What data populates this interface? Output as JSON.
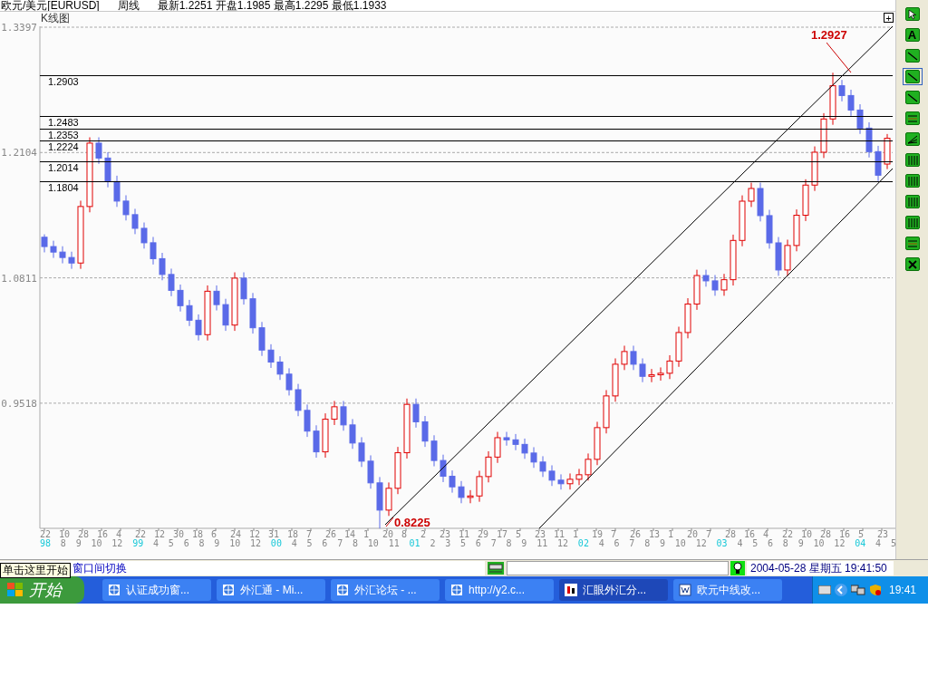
{
  "header": {
    "symbol": "欧元/美元[EURUSD]",
    "period": "周线",
    "quote": "最新1.2251 开盘1.1985 最高1.2295 最低1.1933"
  },
  "chart": {
    "title": "K线图",
    "expand_button": "+",
    "chart_data": {
      "type": "candlestick",
      "grid": true,
      "ylim": [
        0.8227,
        1.3406
      ],
      "yticks": [
        {
          "value": 1.3397,
          "label": "1.3397"
        },
        {
          "value": 1.2104,
          "label": "1.2104"
        },
        {
          "value": 1.0811,
          "label": "1.0811"
        },
        {
          "value": 0.9518,
          "label": "0.9518"
        }
      ],
      "ohlc": [
        [
          1.123,
          1.126,
          1.1074,
          1.1134
        ],
        [
          1.1134,
          1.1194,
          1.1017,
          1.1077
        ],
        [
          1.1077,
          1.1137,
          1.0961,
          1.1021
        ],
        [
          1.1021,
          1.1081,
          1.0904,
          1.0964
        ],
        [
          1.0964,
          1.1607,
          1.0904,
          1.1547
        ],
        [
          1.1547,
          1.2261,
          1.1487,
          1.2201
        ],
        [
          1.2201,
          1.2261,
          1.1987,
          1.2047
        ],
        [
          1.2047,
          1.2107,
          1.1745,
          1.1805
        ],
        [
          1.1805,
          1.1865,
          1.1543,
          1.1603
        ],
        [
          1.1603,
          1.1663,
          1.1403,
          1.1463
        ],
        [
          1.1463,
          1.1523,
          1.1262,
          1.1322
        ],
        [
          1.1322,
          1.1382,
          1.1113,
          1.1173
        ],
        [
          1.1173,
          1.1233,
          1.0949,
          1.1009
        ],
        [
          1.1009,
          1.1069,
          1.0786,
          1.0846
        ],
        [
          1.0846,
          1.0906,
          1.0622,
          1.0682
        ],
        [
          1.0682,
          1.0742,
          1.0464,
          1.0524
        ],
        [
          1.0524,
          1.0584,
          1.0314,
          1.0374
        ],
        [
          1.0374,
          1.0434,
          1.0165,
          1.0225
        ],
        [
          1.0225,
          1.0733,
          1.0165,
          1.0673
        ],
        [
          1.0673,
          1.0733,
          1.0475,
          1.0535
        ],
        [
          1.0535,
          1.0595,
          1.0264,
          1.0324
        ],
        [
          1.0324,
          1.0868,
          1.0264,
          1.0808
        ],
        [
          1.0808,
          1.0868,
          1.0535,
          1.0595
        ],
        [
          1.0595,
          1.0655,
          1.0236,
          1.0296
        ],
        [
          1.0296,
          1.0356,
          1.0006,
          1.0066
        ],
        [
          1.0066,
          1.0126,
          0.9882,
          0.9942
        ],
        [
          0.9942,
          1.0002,
          0.9758,
          0.9818
        ],
        [
          0.9818,
          0.9878,
          0.9597,
          0.9657
        ],
        [
          0.9657,
          0.9717,
          0.9384,
          0.9444
        ],
        [
          0.9444,
          0.9504,
          0.917,
          0.923
        ],
        [
          0.923,
          0.929,
          0.8956,
          0.9016
        ],
        [
          0.9016,
          0.9413,
          0.8956,
          0.9353
        ],
        [
          0.9353,
          0.9541,
          0.9293,
          0.9481
        ],
        [
          0.9481,
          0.9541,
          0.9234,
          0.9294
        ],
        [
          0.9294,
          0.9354,
          0.9047,
          0.9107
        ],
        [
          0.9107,
          0.9167,
          0.886,
          0.892
        ],
        [
          0.892,
          0.898,
          0.8636,
          0.8696
        ],
        [
          0.8696,
          0.8756,
          0.8225,
          0.8415
        ],
        [
          0.8415,
          0.87,
          0.8355,
          0.864
        ],
        [
          0.864,
          0.9067,
          0.858,
          0.9007
        ],
        [
          0.9007,
          0.9566,
          0.8947,
          0.9506
        ],
        [
          0.9506,
          0.9566,
          0.9266,
          0.9326
        ],
        [
          0.9326,
          0.9386,
          0.9067,
          0.9127
        ],
        [
          0.9127,
          0.9187,
          0.8867,
          0.8927
        ],
        [
          0.8927,
          0.8987,
          0.8704,
          0.8764
        ],
        [
          0.8764,
          0.8824,
          0.8595,
          0.8655
        ],
        [
          0.8655,
          0.8715,
          0.8486,
          0.8546
        ],
        [
          0.8546,
          0.8621,
          0.8486,
          0.8561
        ],
        [
          0.8561,
          0.8821,
          0.8501,
          0.8761
        ],
        [
          0.8761,
          0.9022,
          0.8701,
          0.8962
        ],
        [
          0.8962,
          0.9222,
          0.8902,
          0.9162
        ],
        [
          0.9162,
          0.9222,
          0.908,
          0.914
        ],
        [
          0.914,
          0.92,
          0.9033,
          0.9093
        ],
        [
          0.9093,
          0.9153,
          0.8944,
          0.9004
        ],
        [
          0.9004,
          0.9064,
          0.8851,
          0.8911
        ],
        [
          0.8911,
          0.8971,
          0.8757,
          0.8817
        ],
        [
          0.8817,
          0.8877,
          0.8664,
          0.8724
        ],
        [
          0.8724,
          0.8784,
          0.8627,
          0.8687
        ],
        [
          0.8687,
          0.8793,
          0.8627,
          0.8733
        ],
        [
          0.8733,
          0.884,
          0.8673,
          0.878
        ],
        [
          0.878,
          0.8999,
          0.872,
          0.8939
        ],
        [
          0.8939,
          0.9326,
          0.8879,
          0.9266
        ],
        [
          0.9266,
          0.9653,
          0.9206,
          0.9593
        ],
        [
          0.9593,
          0.998,
          0.9533,
          0.992
        ],
        [
          0.992,
          1.0111,
          0.986,
          1.0051
        ],
        [
          1.0051,
          1.0111,
          0.986,
          0.992
        ],
        [
          0.992,
          0.998,
          0.9735,
          0.9795
        ],
        [
          0.9795,
          0.9871,
          0.9735,
          0.9811
        ],
        [
          0.9811,
          0.9887,
          0.9751,
          0.9827
        ],
        [
          0.9827,
          1.0013,
          0.9767,
          0.9953
        ],
        [
          0.9953,
          1.0307,
          0.9893,
          1.0247
        ],
        [
          1.0247,
          1.0601,
          1.0187,
          1.0541
        ],
        [
          1.0541,
          1.0895,
          1.0481,
          1.0835
        ],
        [
          1.0835,
          1.0895,
          1.072,
          1.078
        ],
        [
          1.078,
          1.084,
          1.0626,
          1.0686
        ],
        [
          1.0686,
          1.0852,
          1.0626,
          1.0792
        ],
        [
          1.0792,
          1.1257,
          1.0732,
          1.1197
        ],
        [
          1.1197,
          1.1662,
          1.1137,
          1.1602
        ],
        [
          1.1602,
          1.1793,
          1.1542,
          1.1733
        ],
        [
          1.1733,
          1.1793,
          1.1393,
          1.1453
        ],
        [
          1.1453,
          1.1513,
          1.1112,
          1.1172
        ],
        [
          1.1172,
          1.1232,
          1.0832,
          1.0892
        ],
        [
          1.0892,
          1.1205,
          1.0832,
          1.1145
        ],
        [
          1.1145,
          1.1517,
          1.1085,
          1.1457
        ],
        [
          1.1457,
          1.1828,
          1.1397,
          1.1768
        ],
        [
          1.1768,
          1.2167,
          1.1708,
          1.2107
        ],
        [
          1.2107,
          1.251,
          1.2047,
          1.245
        ],
        [
          1.245,
          1.2927,
          1.239,
          1.2793
        ],
        [
          1.2793,
          1.2853,
          1.2632,
          1.2692
        ],
        [
          1.2692,
          1.2752,
          1.2482,
          1.2542
        ],
        [
          1.2542,
          1.2602,
          1.2296,
          1.2356
        ],
        [
          1.2356,
          1.2416,
          1.2053,
          1.2113
        ],
        [
          1.2113,
          1.2173,
          1.181,
          1.187
        ],
        [
          1.1985,
          1.2295,
          1.1933,
          1.2251
        ]
      ]
    },
    "levels": [
      "1.2903",
      "1.2483",
      "1.2353",
      "1.2224",
      "1.2014",
      "1.1804"
    ],
    "annotations": [
      {
        "text": "1.2927",
        "kind": "high"
      },
      {
        "text": "0.8225",
        "kind": "low"
      }
    ],
    "x_days": [
      "22",
      "10",
      "28",
      "16",
      "4",
      "22",
      "12",
      "30",
      "18",
      "6",
      "24",
      "12",
      "31",
      "18",
      "7",
      "26",
      "14",
      "1",
      "20",
      "8",
      "2",
      "23",
      "11",
      "29",
      "17",
      "5",
      "23",
      "11",
      "1",
      "19",
      "7",
      "26",
      "13",
      "1",
      "20",
      "7",
      "28",
      "16",
      "4",
      "22",
      "10",
      "28",
      "16",
      "5",
      "23"
    ],
    "x_months": [
      {
        "text": "98",
        "year": true
      },
      {
        "text": "8",
        "year": false
      },
      {
        "text": "9",
        "year": false
      },
      {
        "text": "10",
        "year": false
      },
      {
        "text": "12",
        "year": false
      },
      {
        "text": "99",
        "year": true
      },
      {
        "text": "4",
        "year": false
      },
      {
        "text": "5",
        "year": false
      },
      {
        "text": "6",
        "year": false
      },
      {
        "text": "8",
        "year": false
      },
      {
        "text": "9",
        "year": false
      },
      {
        "text": "10",
        "year": false
      },
      {
        "text": "12",
        "year": false
      },
      {
        "text": "00",
        "year": true
      },
      {
        "text": "4",
        "year": false
      },
      {
        "text": "5",
        "year": false
      },
      {
        "text": "6",
        "year": false
      },
      {
        "text": "7",
        "year": false
      },
      {
        "text": "8",
        "year": false
      },
      {
        "text": "10",
        "year": false
      },
      {
        "text": "11",
        "year": false
      },
      {
        "text": "01",
        "year": true
      },
      {
        "text": "2",
        "year": false
      },
      {
        "text": "3",
        "year": false
      },
      {
        "text": "5",
        "year": false
      },
      {
        "text": "6",
        "year": false
      },
      {
        "text": "7",
        "year": false
      },
      {
        "text": "8",
        "year": false
      },
      {
        "text": "9",
        "year": false
      },
      {
        "text": "11",
        "year": false
      },
      {
        "text": "12",
        "year": false
      },
      {
        "text": "02",
        "year": true
      },
      {
        "text": "4",
        "year": false
      },
      {
        "text": "6",
        "year": false
      },
      {
        "text": "7",
        "year": false
      },
      {
        "text": "8",
        "year": false
      },
      {
        "text": "9",
        "year": false
      },
      {
        "text": "10",
        "year": false
      },
      {
        "text": "12",
        "year": false
      },
      {
        "text": "03",
        "year": true
      },
      {
        "text": "4",
        "year": false
      },
      {
        "text": "5",
        "year": false
      },
      {
        "text": "6",
        "year": false
      },
      {
        "text": "8",
        "year": false
      },
      {
        "text": "9",
        "year": false
      },
      {
        "text": "10",
        "year": false
      },
      {
        "text": "12",
        "year": false
      },
      {
        "text": "04",
        "year": true
      },
      {
        "text": "4",
        "year": false
      },
      {
        "text": "5",
        "year": false
      }
    ]
  },
  "toolbar": [
    {
      "kind": "pointer",
      "selected": false
    },
    {
      "kind": "text",
      "label": "A",
      "selected": false
    },
    {
      "kind": "line",
      "selected": false
    },
    {
      "kind": "line",
      "selected": true
    },
    {
      "kind": "line",
      "selected": false
    },
    {
      "kind": "bars",
      "selected": false
    },
    {
      "kind": "fan",
      "selected": false
    },
    {
      "kind": "grid",
      "selected": false
    },
    {
      "kind": "grid",
      "selected": false
    },
    {
      "kind": "grid",
      "selected": false
    },
    {
      "kind": "grid",
      "selected": false
    },
    {
      "kind": "bars",
      "selected": false
    },
    {
      "kind": "delete",
      "selected": false
    }
  ],
  "status_bar": {
    "message": "窗口间切换",
    "clock": "2004-05-28 星期五 19:41:50"
  },
  "tooltip": "单击这里开始",
  "taskbar": {
    "start": "开始",
    "tasks": [
      {
        "label": "认证成功窗...",
        "kind": "browser",
        "selected": false
      },
      {
        "label": "外汇通 - Mi...",
        "kind": "browser",
        "selected": false
      },
      {
        "label": "外汇论坛 - ...",
        "kind": "browser",
        "selected": false
      },
      {
        "label": "http://y2.c...",
        "kind": "browser",
        "selected": false
      },
      {
        "label": "汇眼外汇分...",
        "kind": "chart",
        "selected": true
      },
      {
        "label": "欧元中线改...",
        "kind": "document",
        "selected": false
      }
    ],
    "clock": "19:41"
  }
}
